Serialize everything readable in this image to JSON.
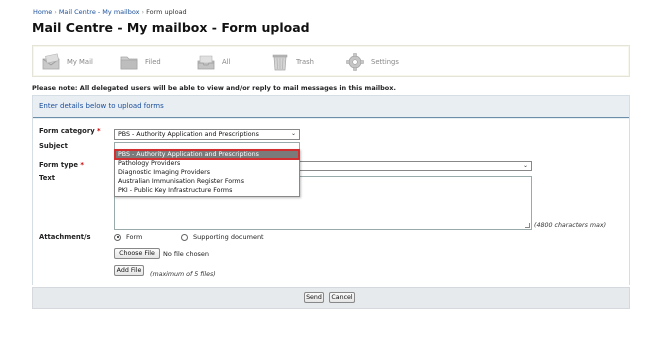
{
  "breadcrumb": {
    "home": "Home",
    "mail_centre": "Mail Centre - My mailbox",
    "current": "Form upload"
  },
  "page": {
    "title": "Mail Centre - My mailbox - Form upload"
  },
  "toolbar": {
    "items": [
      {
        "label": "My Mail",
        "icon": "mail-icon"
      },
      {
        "label": "Filed",
        "icon": "folder-icon"
      },
      {
        "label": "All",
        "icon": "inbox-tray-icon"
      },
      {
        "label": "Trash",
        "icon": "trash-icon"
      },
      {
        "label": "Settings",
        "icon": "gear-icon"
      }
    ]
  },
  "notice": "Please note: All delegated users will be able to view and/or reply to mail messages in this mailbox.",
  "form": {
    "header": "Enter details below to upload forms",
    "category": {
      "label": "Form category",
      "required_marker": "*",
      "selected": "PBS - Authority Application and Prescriptions",
      "options": [
        "PBS - Authority Application and Prescriptions",
        "Pathology Providers",
        "Diagnostic Imaging Providers",
        "Australian Immunisation Register Forms",
        "PKI - Public Key Infrastructure Forms"
      ],
      "highlighted_index": 0
    },
    "subject": {
      "label": "Subject",
      "value": ""
    },
    "form_type": {
      "label": "Form type",
      "required_marker": "*",
      "value": ""
    },
    "text": {
      "label": "Text",
      "value": "",
      "counter": "(4800 characters max)"
    },
    "attachments": {
      "label": "Attachment/s",
      "radio_form": "Form",
      "radio_supporting": "Supporting document",
      "selected": "Form",
      "choose_file": "Choose File",
      "file_status": "No file chosen",
      "add_file": "Add File",
      "max_files": "(maximum of 5 files)"
    },
    "actions": {
      "send": "Send",
      "cancel": "Cancel"
    }
  }
}
